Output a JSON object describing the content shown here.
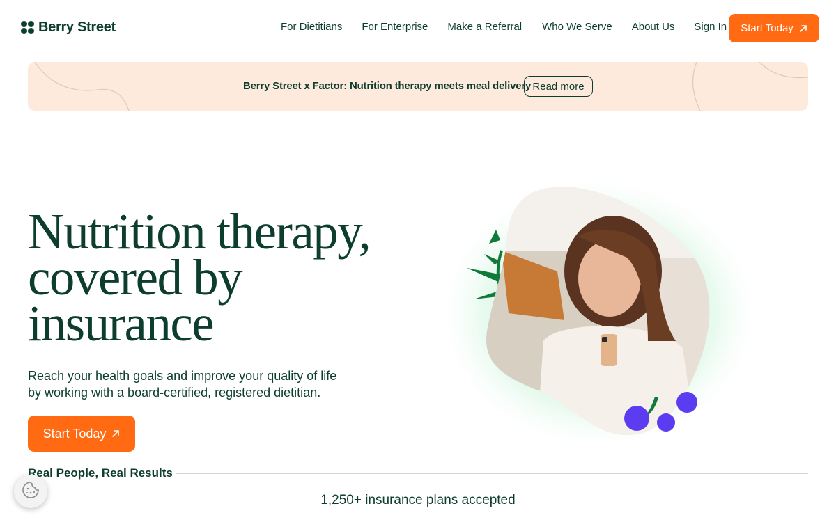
{
  "brand": {
    "name": "Berry Street"
  },
  "nav": {
    "links": [
      "For Dietitians",
      "For Enterprise",
      "Make a Referral",
      "Who We Serve",
      "About Us",
      "Sign In"
    ],
    "cta_label": "Start Today"
  },
  "banner": {
    "text": "Berry Street x Factor: Nutrition therapy meets meal delivery",
    "button_label": "Read more"
  },
  "hero": {
    "title_lines": [
      "Nutrition therapy,",
      "covered by",
      "insurance"
    ],
    "subtitle": "Reach your health goals and improve your quality of life by working with a board-certified, registered dietitian.",
    "cta_label": "Start Today"
  },
  "results": {
    "heading": "Real People, Real Results",
    "plans_text": "1,250+ insurance plans accepted"
  },
  "colors": {
    "brand_green": "#0c3d2e",
    "accent_orange": "#ff6a13",
    "banner_peach": "#fdeadc",
    "berry_purple": "#5b3cf0"
  },
  "icons": [
    "arrow-up-right-icon",
    "logo-mark-icon",
    "cookie-icon"
  ]
}
